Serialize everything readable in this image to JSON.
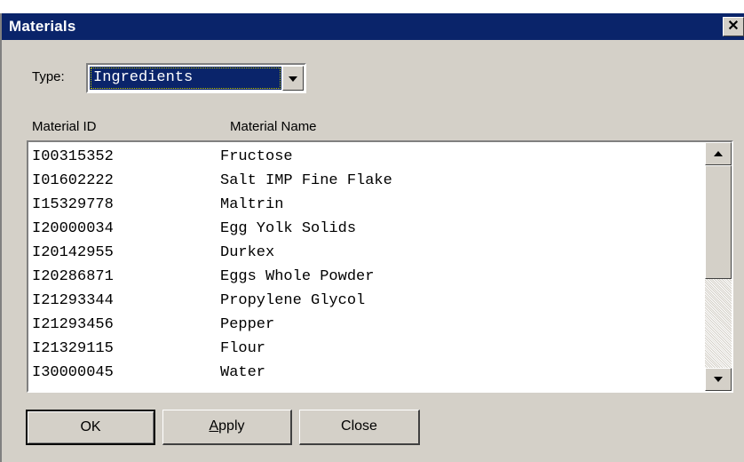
{
  "window": {
    "title": "Materials",
    "close_glyph": "✕"
  },
  "type_field": {
    "label": "Type:",
    "value": "Ingredients"
  },
  "columns": {
    "id": "Material ID",
    "name": "Material Name"
  },
  "rows": [
    {
      "id": "I00315352",
      "name": "Fructose"
    },
    {
      "id": "I01602222",
      "name": "Salt IMP Fine Flake"
    },
    {
      "id": "I15329778",
      "name": "Maltrin"
    },
    {
      "id": "I20000034",
      "name": "Egg Yolk Solids"
    },
    {
      "id": "I20142955",
      "name": "Durkex"
    },
    {
      "id": "I20286871",
      "name": "Eggs Whole Powder"
    },
    {
      "id": "I21293344",
      "name": "Propylene Glycol"
    },
    {
      "id": "I21293456",
      "name": "Pepper"
    },
    {
      "id": "I21329115",
      "name": "Flour"
    },
    {
      "id": "I30000045",
      "name": "Water"
    }
  ],
  "buttons": {
    "ok": "OK",
    "apply_mnemonic": "A",
    "apply_rest": "pply",
    "close": "Close"
  },
  "icons": {
    "close": "close-icon",
    "dropdown": "chevron-down-icon",
    "scroll_up": "scroll-up-arrow-icon",
    "scroll_down": "scroll-down-arrow-icon"
  },
  "colors": {
    "titlebar": "#0a246a",
    "face": "#d4d0c8",
    "selection": "#0a246a"
  }
}
